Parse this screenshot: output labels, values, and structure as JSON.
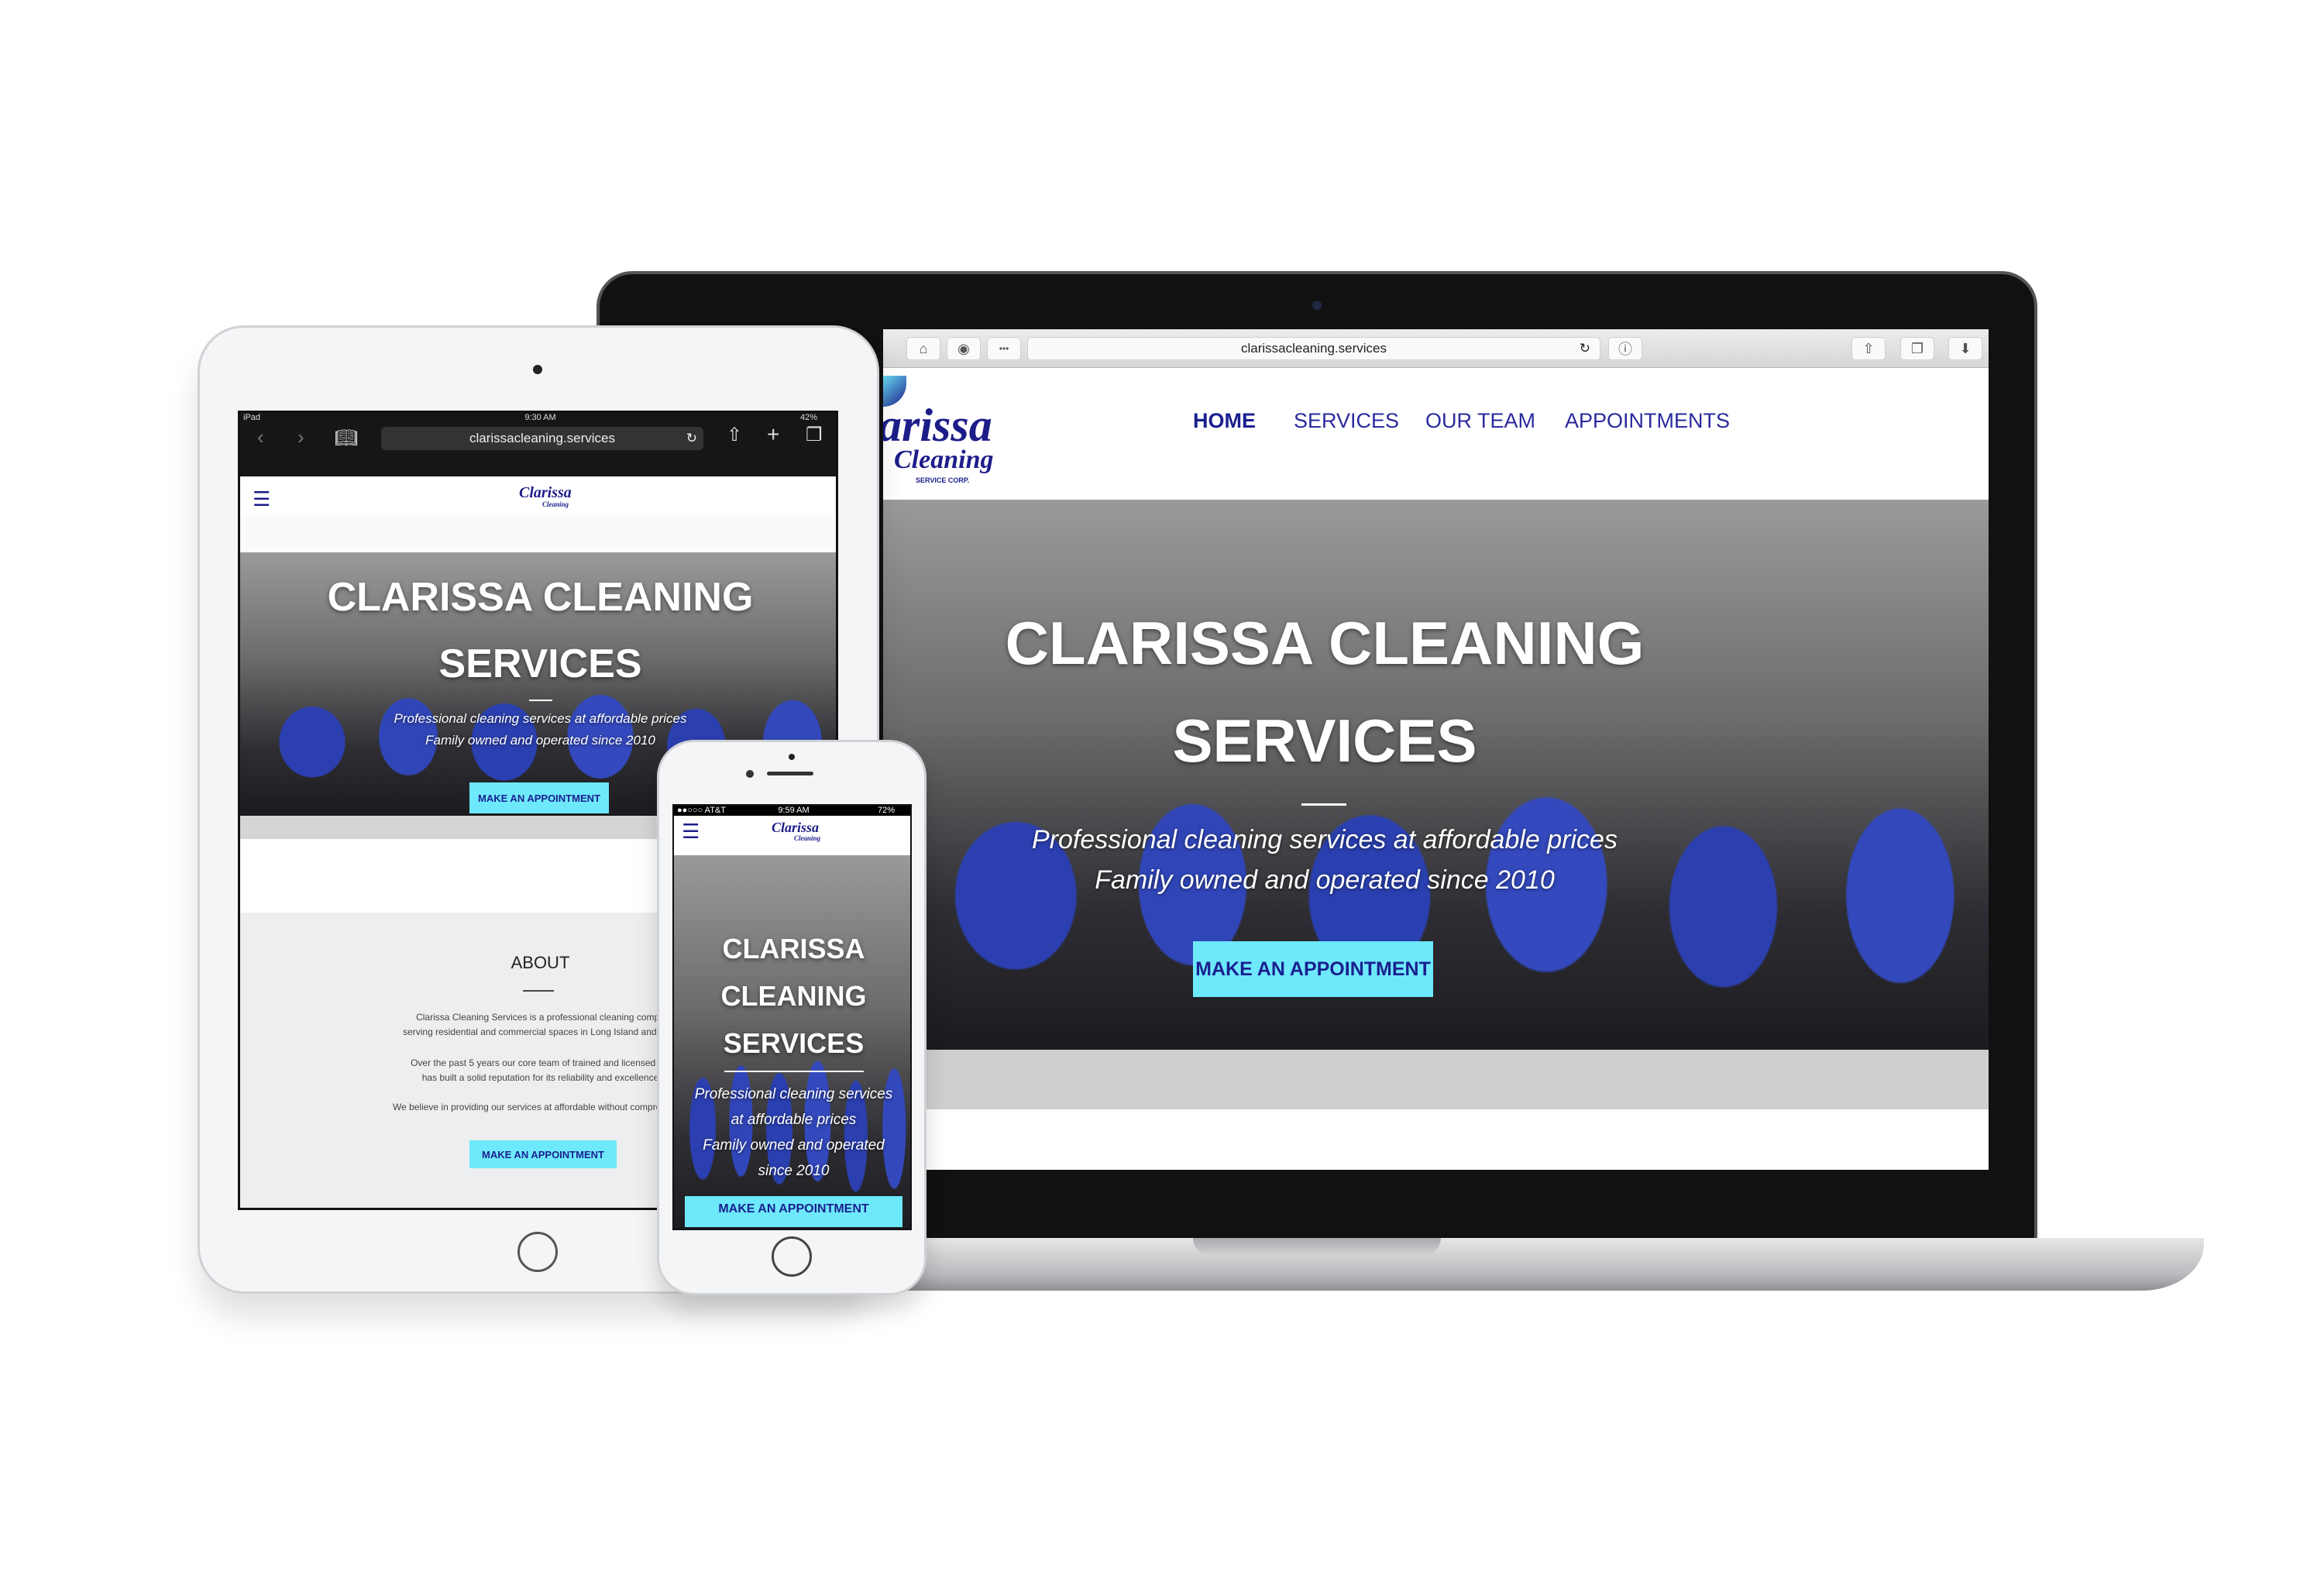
{
  "url": "clarissacleaning.services",
  "laptop": {
    "logo_text": "arissa",
    "logo_sub": "Cleaning",
    "logo_corp": "SERVICE CORP.",
    "nav": [
      {
        "label": "HOME",
        "active": true
      },
      {
        "label": "SERVICES"
      },
      {
        "label": "OUR TEAM"
      },
      {
        "label": "APPOINTMENTS"
      }
    ],
    "hero": {
      "title_line1": "CLARISSA CLEANING",
      "title_line2": "SERVICES",
      "subtitle_line1": "Professional cleaning services at affordable prices",
      "subtitle_line2": "Family owned and operated since 2010",
      "cta": "MAKE AN APPOINTMENT"
    },
    "toolbar_icons": [
      "home-icon",
      "screenshot-icon",
      "more-icon",
      "reload-icon",
      "info-icon",
      "share-icon",
      "tabs-icon",
      "download-icon"
    ]
  },
  "ipad": {
    "status": {
      "device": "iPad",
      "time": "9:30 AM",
      "battery": "42%"
    },
    "logo_text": "Clarissa",
    "logo_sub": "Cleaning",
    "hero": {
      "title_line1": "CLARISSA CLEANING",
      "title_line2": "SERVICES",
      "subtitle_line1": "Professional cleaning services at affordable prices",
      "subtitle_line2": "Family owned and operated since 2010",
      "cta": "MAKE AN APPOINTMENT"
    },
    "about": {
      "heading": "ABOUT",
      "paragraphs": [
        [
          "Clarissa Cleaning Services is a professional cleaning compa",
          "serving residential and commercial spaces in Long Island and New"
        ],
        [
          "Over the past 5 years our core team of trained and licensed cle",
          "has built a solid reputation for its reliability and excellence"
        ],
        [
          "We believe in providing our services at affordable without compromising"
        ]
      ],
      "cta": "MAKE AN APPOINTMENT"
    }
  },
  "iphone": {
    "status": {
      "carrier": "●●○○○ AT&T",
      "time": "9:59 AM",
      "battery": "72%"
    },
    "logo_text": "Clarissa",
    "logo_sub": "Cleaning",
    "hero": {
      "title_lines": [
        "CLARISSA",
        "CLEANING",
        "SERVICES"
      ],
      "subtitle_lines": [
        "Professional cleaning services",
        "at affordable prices",
        "Family owned and operated",
        "since 2010"
      ],
      "cta": "MAKE AN APPOINTMENT"
    }
  },
  "colors": {
    "accent": "#6de9fb",
    "brand": "#1d1d8a",
    "nav": "#2a2a9e"
  }
}
